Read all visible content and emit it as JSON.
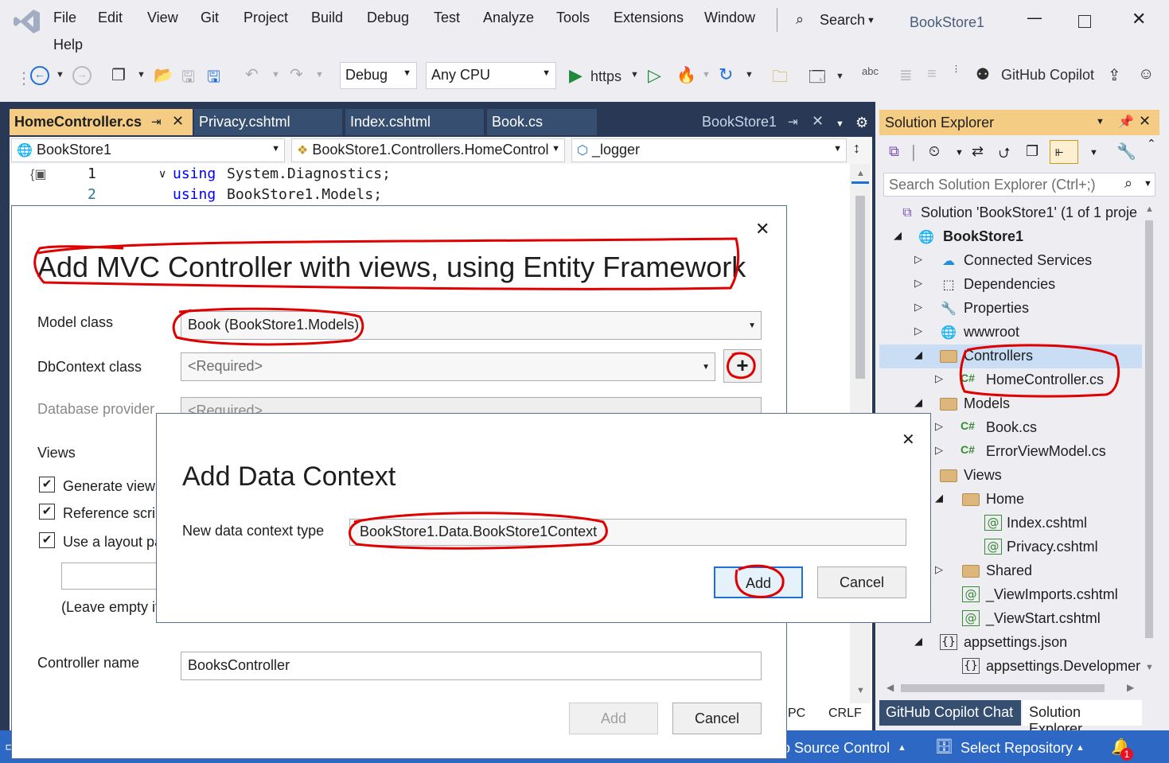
{
  "menu": {
    "items": [
      "File",
      "Edit",
      "View",
      "Git",
      "Project",
      "Build",
      "Debug",
      "Test",
      "Analyze",
      "Tools",
      "Extensions",
      "Window"
    ],
    "help": "Help",
    "search": "Search",
    "solution_name": "BookStore1"
  },
  "toolbar": {
    "config": "Debug",
    "platform": "Any CPU",
    "run_target": "https",
    "copilot": "GitHub Copilot"
  },
  "tabs": {
    "active": "HomeController.cs",
    "others": [
      "Privacy.cshtml",
      "Index.cshtml",
      "Book.cs"
    ],
    "right": "BookStore1"
  },
  "navbar": {
    "project": "BookStore1",
    "class": "BookStore1.Controllers.HomeControl",
    "member": "_logger"
  },
  "code": {
    "lines": [
      {
        "num": "1",
        "kw": "using",
        "rest": "System.Diagnostics;"
      },
      {
        "num": "2",
        "kw": "using",
        "rest": "BookStore1.Models;"
      }
    ]
  },
  "solution_explorer": {
    "title": "Solution Explorer",
    "search_placeholder": "Search Solution Explorer (Ctrl+;)",
    "items": [
      {
        "label": "Solution 'BookStore1' (1 of 1 proje"
      },
      {
        "label": "BookStore1"
      },
      {
        "label": "Connected Services"
      },
      {
        "label": "Dependencies"
      },
      {
        "label": "Properties"
      },
      {
        "label": "wwwroot"
      },
      {
        "label": "Controllers"
      },
      {
        "label": "HomeController.cs"
      },
      {
        "label": "Models"
      },
      {
        "label": "Book.cs"
      },
      {
        "label": "ErrorViewModel.cs"
      },
      {
        "label": "Views"
      },
      {
        "label": "Home"
      },
      {
        "label": "Index.cshtml"
      },
      {
        "label": "Privacy.cshtml"
      },
      {
        "label": "Shared"
      },
      {
        "label": "_ViewImports.cshtml"
      },
      {
        "label": "_ViewStart.cshtml"
      },
      {
        "label": "appsettings.json"
      },
      {
        "label": "appsettings.Developmer"
      }
    ],
    "bottom_tabs": [
      "GitHub Copilot Chat",
      "Solution Explorer"
    ],
    "cs_tag": "C#"
  },
  "editor_status": {
    "encoding": "PC",
    "eol": "CRLF"
  },
  "statusbar": {
    "source_control": "o Source Control",
    "repository": "Select Repository",
    "notifications": "1"
  },
  "mvc_dialog": {
    "title": "Add MVC Controller with views, using Entity Framework",
    "model_class_label": "Model class",
    "model_class_value": "Book (BookStore1.Models)",
    "dbcontext_label": "DbContext class",
    "dbcontext_value": "<Required>",
    "db_provider_label": "Database provider",
    "db_provider_value": "<Required>",
    "views_label": "Views",
    "generate_views": "Generate views",
    "reference_scripts": "Reference scrip",
    "use_layout": "Use a layout pa",
    "leave_empty": "(Leave empty if",
    "controller_name_label": "Controller name",
    "controller_name_value": "BooksController",
    "add": "Add",
    "cancel": "Cancel"
  },
  "data_context_dialog": {
    "title": "Add Data Context",
    "type_label": "New data context type",
    "type_value": "BookStore1.Data.BookStore1Context",
    "add": "Add",
    "cancel": "Cancel"
  },
  "colors": {
    "accent": "#2D68C4",
    "annotation": "#E00000",
    "tab_active": "#F5CC84"
  }
}
